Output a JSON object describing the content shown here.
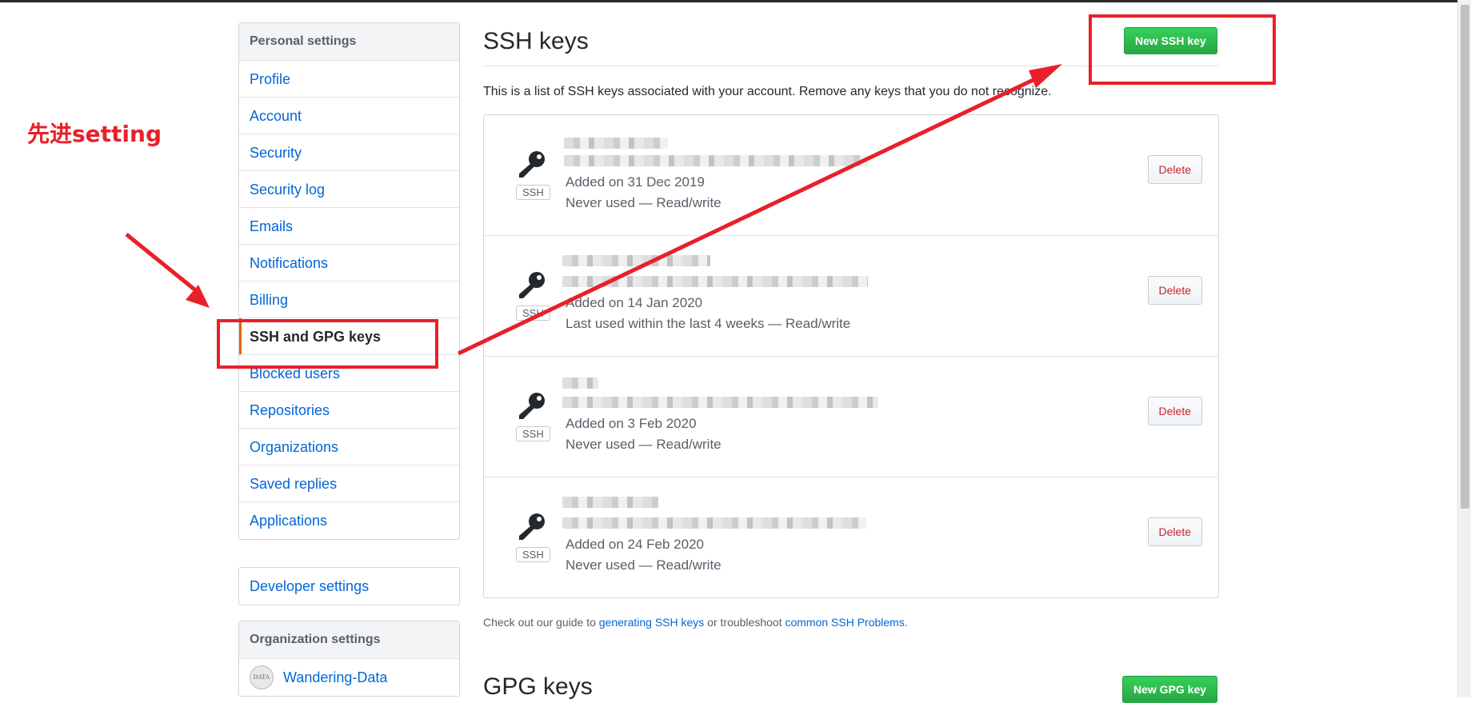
{
  "sidebar": {
    "personal_heading": "Personal settings",
    "items": [
      {
        "label": "Profile"
      },
      {
        "label": "Account"
      },
      {
        "label": "Security"
      },
      {
        "label": "Security log"
      },
      {
        "label": "Emails"
      },
      {
        "label": "Notifications"
      },
      {
        "label": "Billing"
      },
      {
        "label": "SSH and GPG keys",
        "selected": true
      },
      {
        "label": "Blocked users"
      },
      {
        "label": "Repositories"
      },
      {
        "label": "Organizations"
      },
      {
        "label": "Saved replies"
      },
      {
        "label": "Applications"
      }
    ],
    "developer_settings": "Developer settings",
    "org_heading": "Organization settings",
    "org_name": "Wandering-Data",
    "org_avatar_text": "DATA"
  },
  "main": {
    "ssh_title": "SSH keys",
    "new_ssh_button": "New SSH key",
    "intro": "This is a list of SSH keys associated with your account. Remove any keys that you do not recognize.",
    "keys": [
      {
        "type": "SSH",
        "added": "Added on 31 Dec 2019",
        "usage": "Never used — Read/write",
        "delete": "Delete"
      },
      {
        "type": "SSH",
        "added": "Added on 14 Jan 2020",
        "usage": "Last used within the last 4 weeks — Read/write",
        "delete": "Delete"
      },
      {
        "type": "SSH",
        "added": "Added on 3 Feb 2020",
        "usage": "Never used — Read/write",
        "delete": "Delete"
      },
      {
        "type": "SSH",
        "added": "Added on 24 Feb 2020",
        "usage": "Never used — Read/write",
        "delete": "Delete"
      }
    ],
    "guide": {
      "prefix": "Check out our guide to ",
      "link1": "generating SSH keys",
      "middle": " or troubleshoot ",
      "link2": "common SSH Problems",
      "suffix": "."
    },
    "gpg_title": "GPG keys",
    "new_gpg_button": "New GPG key"
  },
  "annotation": {
    "text": "先进setting",
    "color": "#e8202a"
  },
  "colors": {
    "link": "#0366d6",
    "green": "#28a745",
    "danger": "#cb2431",
    "selected_accent": "#e36209"
  }
}
